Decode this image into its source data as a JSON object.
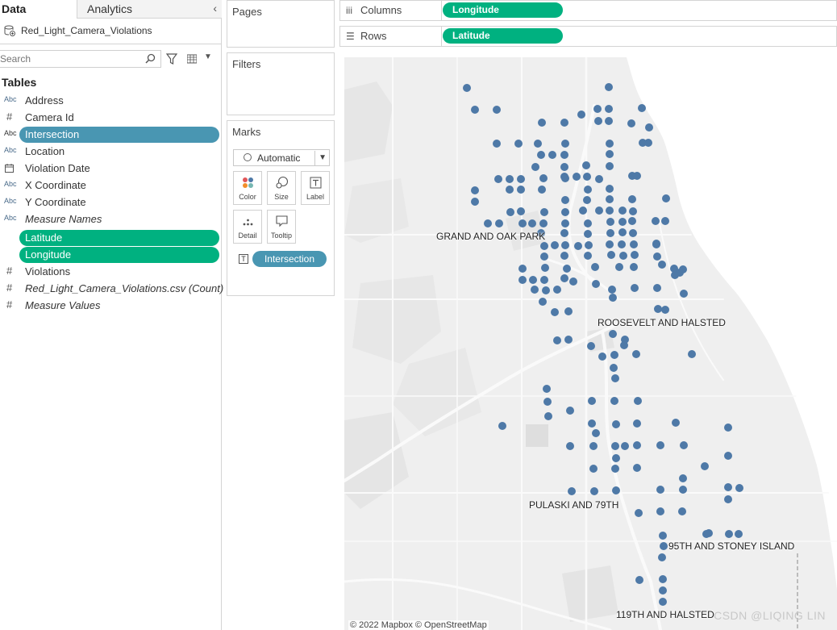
{
  "left_pane": {
    "tabs": {
      "data": "Data",
      "analytics": "Analytics",
      "collapse": "‹"
    },
    "datasource": "Red_Light_Camera_Violations",
    "search_placeholder": "Search",
    "tables_heading": "Tables",
    "fields": [
      {
        "type": "Abc",
        "label": "Address",
        "style": "normal",
        "pill": "none"
      },
      {
        "type": "#",
        "label": "Camera Id",
        "style": "normal",
        "pill": "none"
      },
      {
        "type": "Abc",
        "label": "Intersection",
        "style": "normal",
        "pill": "blue"
      },
      {
        "type": "Abc",
        "label": "Location",
        "style": "normal",
        "pill": "none"
      },
      {
        "type": "calendar",
        "label": "Violation Date",
        "style": "normal",
        "pill": "none"
      },
      {
        "type": "Abc",
        "label": "X Coordinate",
        "style": "normal",
        "pill": "none"
      },
      {
        "type": "Abc",
        "label": "Y Coordinate",
        "style": "normal",
        "pill": "none"
      },
      {
        "type": "Abc",
        "label": "Measure Names",
        "style": "italic",
        "pill": "none"
      },
      {
        "type": "globe",
        "label": "Latitude",
        "style": "normal",
        "pill": "green"
      },
      {
        "type": "globe",
        "label": "Longitude",
        "style": "normal",
        "pill": "green"
      },
      {
        "type": "#",
        "label": "Violations",
        "style": "normal",
        "pill": "none"
      },
      {
        "type": "#",
        "label": "Red_Light_Camera_Violations.csv (Count)",
        "style": "italic",
        "pill": "none"
      },
      {
        "type": "#",
        "label": "Measure Values",
        "style": "italic",
        "pill": "none"
      }
    ]
  },
  "cards": {
    "pages": "Pages",
    "filters": "Filters",
    "marks": "Marks",
    "mark_type": "Automatic",
    "mark_buttons": {
      "color": "Color",
      "size": "Size",
      "label": "Label",
      "detail": "Detail",
      "tooltip": "Tooltip"
    },
    "marks_field": "Intersection"
  },
  "shelves": {
    "columns_label": "Columns",
    "columns_pill": "Longitude",
    "rows_label": "Rows",
    "rows_pill": "Latitude"
  },
  "map": {
    "mark_color": "#4e79a7",
    "labels": {
      "grand_oak": "GRAND AND OAK PARK",
      "roosevelt": "ROOSEVELT AND HALSTED",
      "pulaski": "PULASKI AND 79TH",
      "stoney": "95TH AND STONEY ISLAND",
      "halsted119": "119TH AND HALSTED"
    },
    "attribution": "© 2022 Mapbox © OpenStreetMap",
    "watermark": "CSDN @LIQING LIN"
  },
  "colors": {
    "measure_green": "#00b180",
    "dimension_blue": "#4996b2",
    "map_land": "#efefef"
  }
}
